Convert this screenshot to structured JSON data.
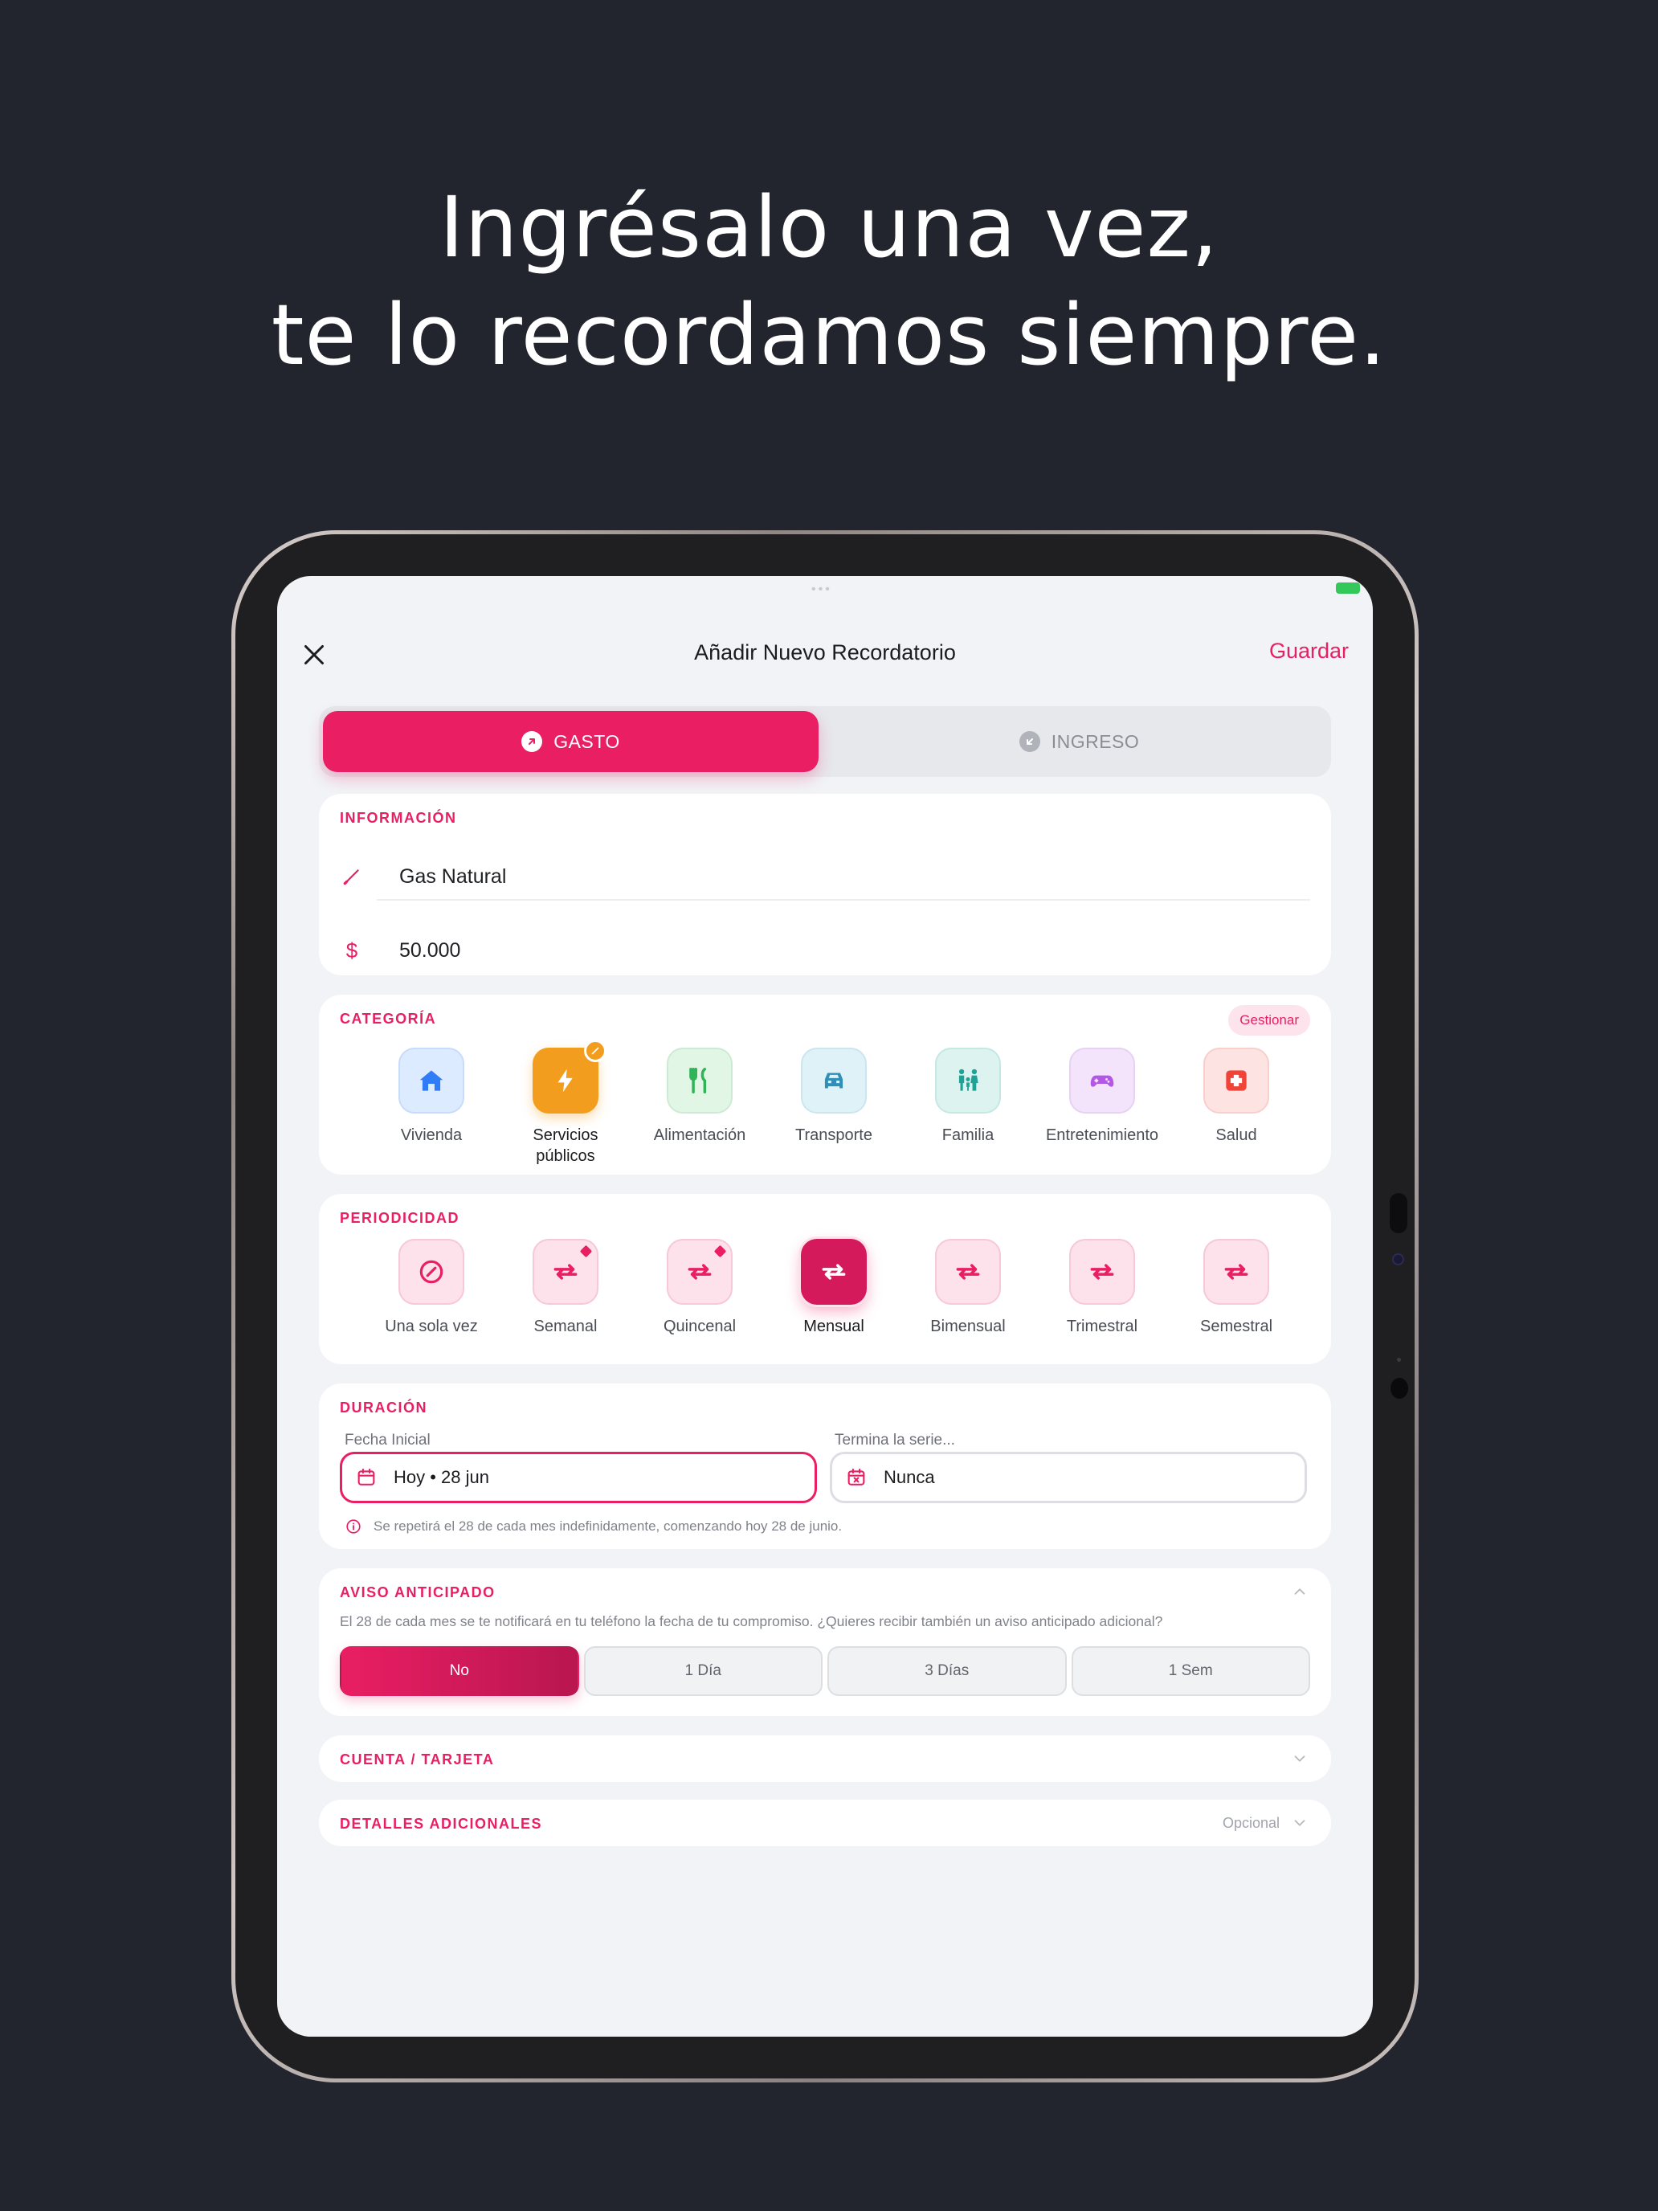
{
  "headline": {
    "line1": "Ingrésalo una vez,",
    "line2": "te lo recordamos siempre."
  },
  "status": {
    "dots": "•••"
  },
  "nav": {
    "title": "Añadir Nuevo Recordatorio",
    "save": "Guardar",
    "close_icon": "close-icon"
  },
  "type_toggle": {
    "expense": "GASTO",
    "income": "INGRESO",
    "selected": "expense"
  },
  "info": {
    "label": "INFORMACIÓN",
    "name": "Gas Natural",
    "currency_symbol": "$",
    "amount": "50.000"
  },
  "category": {
    "label": "CATEGORÍA",
    "manage": "Gestionar",
    "items": [
      {
        "label": "Vivienda",
        "icon": "home-icon",
        "color": "#2f7cf6",
        "bg": "#dcebff"
      },
      {
        "label": "Servicios públicos",
        "label_line1": "Servicios",
        "label_line2": "públicos",
        "icon": "bolt-icon",
        "color": "#ffffff",
        "bg": "#f29d1e",
        "selected": true
      },
      {
        "label": "Alimentación",
        "icon": "utensils-icon",
        "color": "#2fb457",
        "bg": "#e2f6e6"
      },
      {
        "label": "Transporte",
        "icon": "car-icon",
        "color": "#2f8fb6",
        "bg": "#dff2f7"
      },
      {
        "label": "Familia",
        "icon": "family-icon",
        "color": "#1ea296",
        "bg": "#dcf3f0"
      },
      {
        "label": "Entretenimiento",
        "icon": "gamepad-icon",
        "color": "#b357e6",
        "bg": "#f3e4fb"
      },
      {
        "label": "Salud",
        "icon": "medical-icon",
        "color": "#f04438",
        "bg": "#fde3e1"
      }
    ]
  },
  "periodicity": {
    "label": "PERIODICIDAD",
    "items": [
      {
        "label": "Una sola vez",
        "icon": "no-repeat-icon"
      },
      {
        "label": "Semanal",
        "icon": "repeat-icon",
        "marker": true
      },
      {
        "label": "Quincenal",
        "icon": "repeat-icon",
        "marker": true
      },
      {
        "label": "Mensual",
        "icon": "repeat-icon",
        "selected": true
      },
      {
        "label": "Bimensual",
        "icon": "repeat-icon"
      },
      {
        "label": "Trimestral",
        "icon": "repeat-icon"
      },
      {
        "label": "Semestral",
        "icon": "repeat-icon"
      }
    ]
  },
  "duration": {
    "label": "DURACIÓN",
    "start_label": "Fecha Inicial",
    "start_value": "Hoy • 28 jun",
    "end_label": "Termina la serie...",
    "end_value": "Nunca",
    "hint": "Se repetirá el 28 de cada mes indefinidamente, comenzando hoy 28 de junio."
  },
  "advance_notice": {
    "label": "AVISO ANTICIPADO",
    "text": "El 28 de cada mes se te notificará en tu teléfono la fecha de tu compromiso. ¿Quieres recibir también un aviso anticipado adicional?",
    "options": [
      "No",
      "1 Día",
      "3 Días",
      "1 Sem"
    ],
    "selected": "No"
  },
  "account": {
    "label": "CUENTA / TARJETA"
  },
  "details": {
    "label": "DETALLES ADICIONALES",
    "optional": "Opcional"
  },
  "colors": {
    "accent": "#e91e63",
    "background": "#22252d",
    "screen": "#f1f3f6"
  }
}
